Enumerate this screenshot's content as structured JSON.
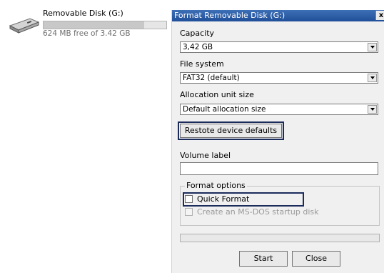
{
  "drive": {
    "name": "Removable Disk (G:)",
    "free_space": "624 MB free of 3.42 GB",
    "used_fraction": 0.82
  },
  "dialog": {
    "title": "Format Removable Disk (G:)",
    "close_glyph": "x",
    "capacity": {
      "label": "Capacity",
      "value": "3,42 GB"
    },
    "file_system": {
      "label": "File system",
      "value": "FAT32 (default)"
    },
    "allocation": {
      "label": "Allocation unit size",
      "value": "Default allocation size"
    },
    "restore_button": "Restote device defaults",
    "volume_label": {
      "label": "Volume label",
      "value": ""
    },
    "format_options": {
      "label": "Format options",
      "quick_format": "Quick Format",
      "ms_dos": "Create an MS-DOS startup disk"
    },
    "progress": 0,
    "start_button": "Start",
    "close_button": "Close"
  }
}
